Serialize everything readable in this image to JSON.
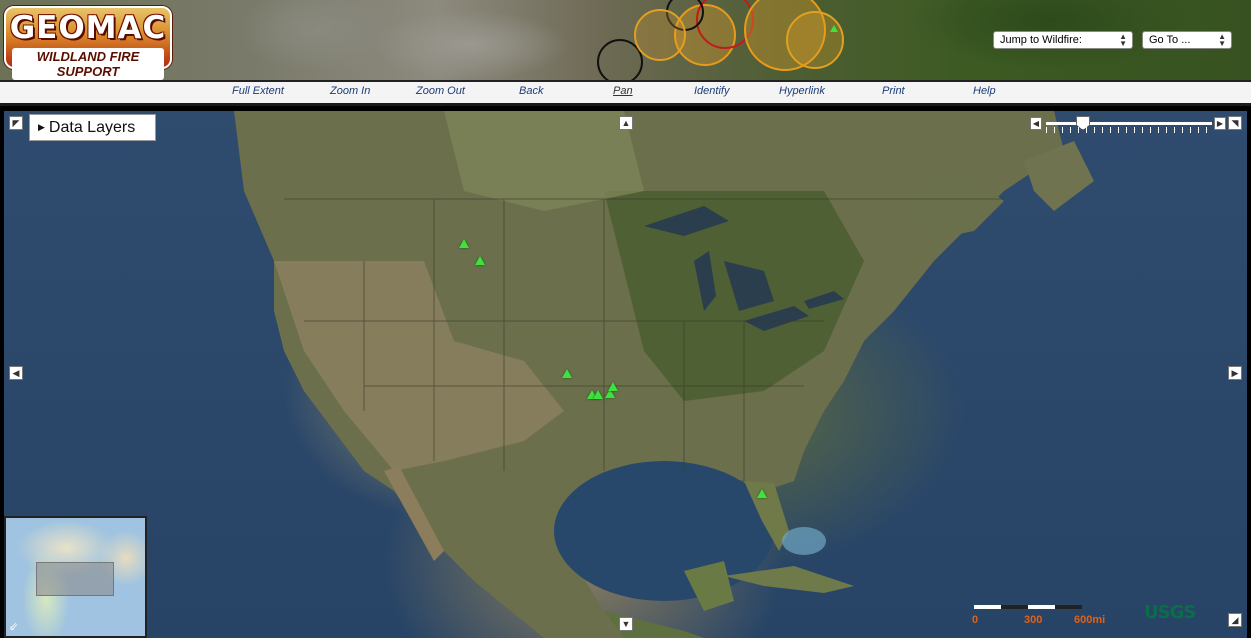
{
  "header": {
    "logo_title": "GEOMAC",
    "logo_subtitle": "WILDLAND FIRE SUPPORT",
    "jump_select": "Jump to Wildfire:",
    "goto_select": "Go To ..."
  },
  "toolbar": {
    "items": [
      {
        "label": "Full Extent"
      },
      {
        "label": "Zoom In"
      },
      {
        "label": "Zoom Out"
      },
      {
        "label": "Back"
      },
      {
        "label": "Pan",
        "active": true
      },
      {
        "label": "Identify"
      },
      {
        "label": "Hyperlink"
      },
      {
        "label": "Print"
      },
      {
        "label": "Help"
      }
    ]
  },
  "map": {
    "data_layers_label": "Data Layers",
    "fire_marker_color": "#3fe03f",
    "fire_marker_count": 8,
    "scalebar": {
      "labels": [
        "0",
        "300",
        "600mi"
      ]
    },
    "attribution": "USGS"
  },
  "colors": {
    "toolbar_link": "#1a3b78",
    "ocean": "#2f4b6e",
    "scale_label": "#e0601a",
    "usgs": "#0a6e4a"
  }
}
